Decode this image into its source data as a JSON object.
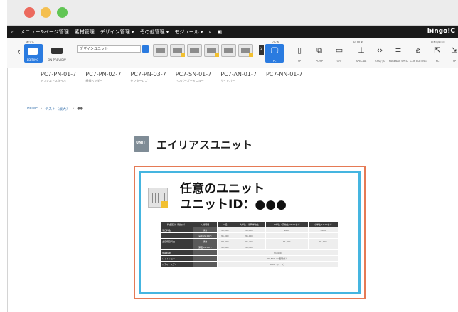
{
  "menubar": {
    "items": [
      "メニュー&ページ管理",
      "素材管理",
      "デザイン管理 ▾",
      "その他管理 ▾",
      "モジュール ▾"
    ],
    "brand": "bingo!C"
  },
  "toolbar": {
    "layout_label": "MODE",
    "device_group_label": "VIEW",
    "block_group_label": "BLOCK",
    "find_label": "FIND/EDIT",
    "select_value": "デザインユニット",
    "mode_buttons": [
      "EDITING",
      "ON PREVIEW"
    ],
    "device_labels": [
      "PC",
      "SP",
      "PC/SP",
      "OFF",
      "SPECIAL",
      "CSS / JS",
      "PAGENAV SPEC",
      "CLIP EDITING",
      "PC",
      "SP"
    ]
  },
  "patterns": [
    {
      "title": "PC7-PN-01-7",
      "sub": "デフォルトスタイル"
    },
    {
      "title": "PC7-PN-02-7",
      "sub": "横幅ヘッダー"
    },
    {
      "title": "PC7-PN-03-7",
      "sub": "センターロゴ"
    },
    {
      "title": "PC7-SN-01-7",
      "sub": "ハンバーガーメニュー"
    },
    {
      "title": "PC7-AN-01-7",
      "sub": "サイドバー"
    },
    {
      "title": "PC7-NN-01-7",
      "sub": ""
    }
  ],
  "breadcrumb": {
    "items": [
      "HOME",
      "テスト（最大）",
      "●●"
    ],
    "separator": "›"
  },
  "unit": {
    "icon_text": "UNIT",
    "title": "エイリアスユニット"
  },
  "any_unit": {
    "title": "任意のユニット",
    "id_line": "ユニットID：●●●"
  },
  "table": {
    "headers": [
      "料金区分（税抜き）",
      "入場時間",
      "一般",
      "大学生・専門学校生",
      "中学生・高校生 21:00まで",
      "小学生 19:00まで"
    ],
    "rows": [
      [
        "平日料金",
        "通常",
        "¥1,000",
        "¥1,000",
        "¥800",
        "¥600"
      ],
      [
        "",
        "深夜 22:00〜",
        "¥1,000",
        "¥1,000",
        "",
        ""
      ],
      [
        "土日祝日料金",
        "通常",
        "¥2,200",
        "¥1,400",
        "¥1,000",
        "¥1,000"
      ],
      [
        "",
        "深夜 22:00〜",
        "¥1,800",
        "¥1,400",
        "",
        ""
      ],
      [
        "会員料金",
        "",
        "¥1,400",
        "",
        "",
        ""
      ],
      [
        "レイトショー",
        "",
        "¥1,500（一部除外）",
        "",
        "",
        ""
      ],
      [
        "レディースデイ",
        "",
        "¥800（レース）",
        "",
        "",
        ""
      ]
    ]
  }
}
